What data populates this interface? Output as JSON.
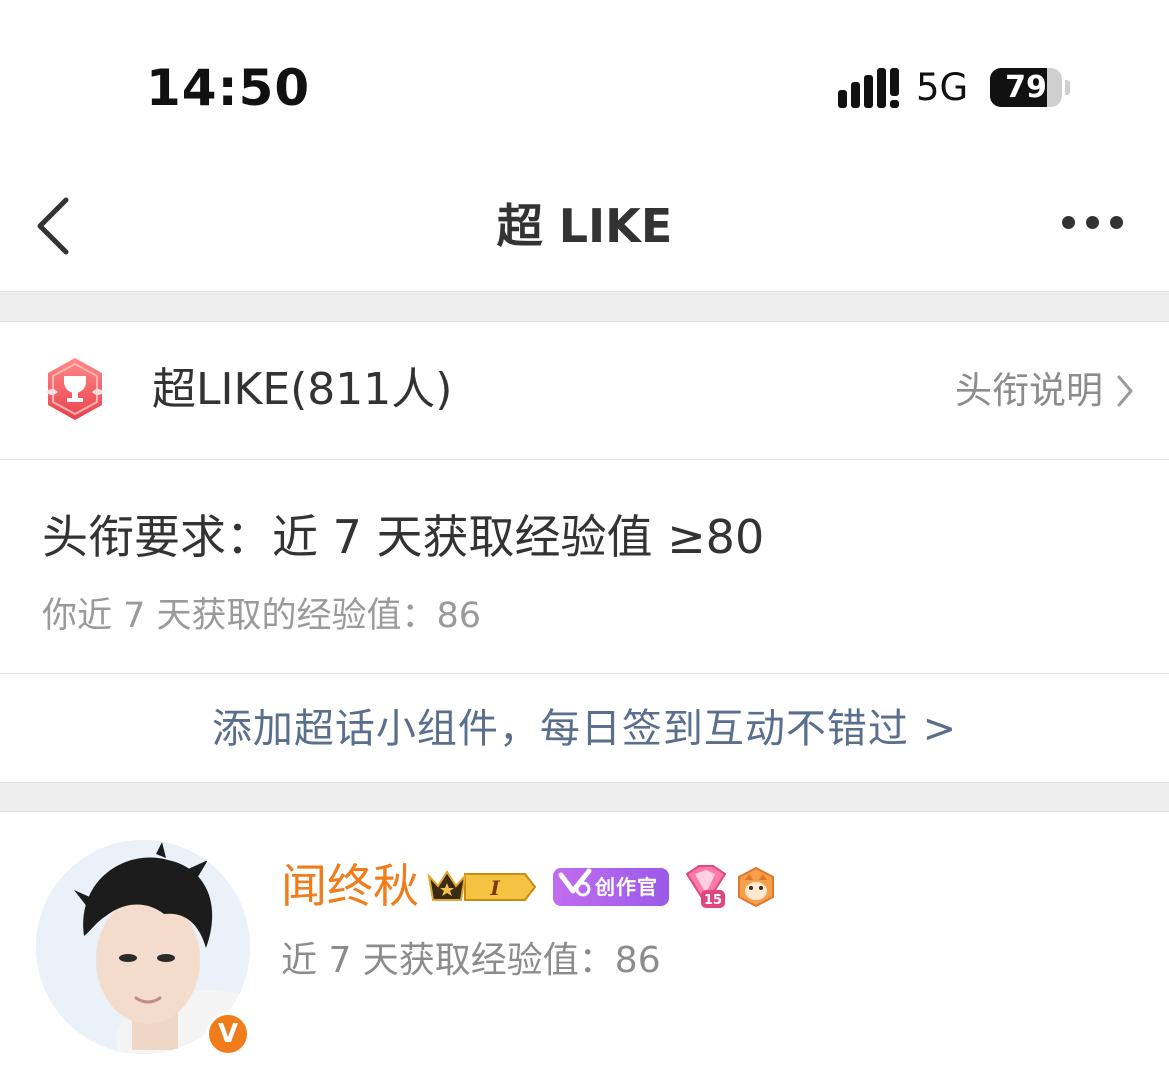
{
  "status_bar": {
    "time": "14:50",
    "network": "5G",
    "battery_level": "79",
    "battery_fraction": 0.79
  },
  "nav": {
    "title": "超 LIKE",
    "back_icon": "chevron-left-icon",
    "more_icon": "more-horizontal-icon"
  },
  "title_row": {
    "icon": "trophy-badge-icon",
    "label": "超LIKE(811人)",
    "explain_label": "头衔说明"
  },
  "requirement": {
    "main": "头衔要求：近 7 天获取经验值 ≥80",
    "sub": "你近 7 天获取的经验值：86"
  },
  "widget_link": {
    "label": "添加超话小组件，每日签到互动不错过 >"
  },
  "member": {
    "name": "闻终秋",
    "level_badge": "I",
    "creator_badge": "创作官",
    "gem_level": "15",
    "exp_text": "近 7 天获取经验值：86",
    "verified_icon": "v-verified-icon"
  },
  "colors": {
    "accent_orange": "#f07c1b",
    "link_blue": "#5a6e8e",
    "gray_text": "#8c8c8c",
    "divider_bg": "#ededed",
    "badge_red": "#f0525a"
  }
}
